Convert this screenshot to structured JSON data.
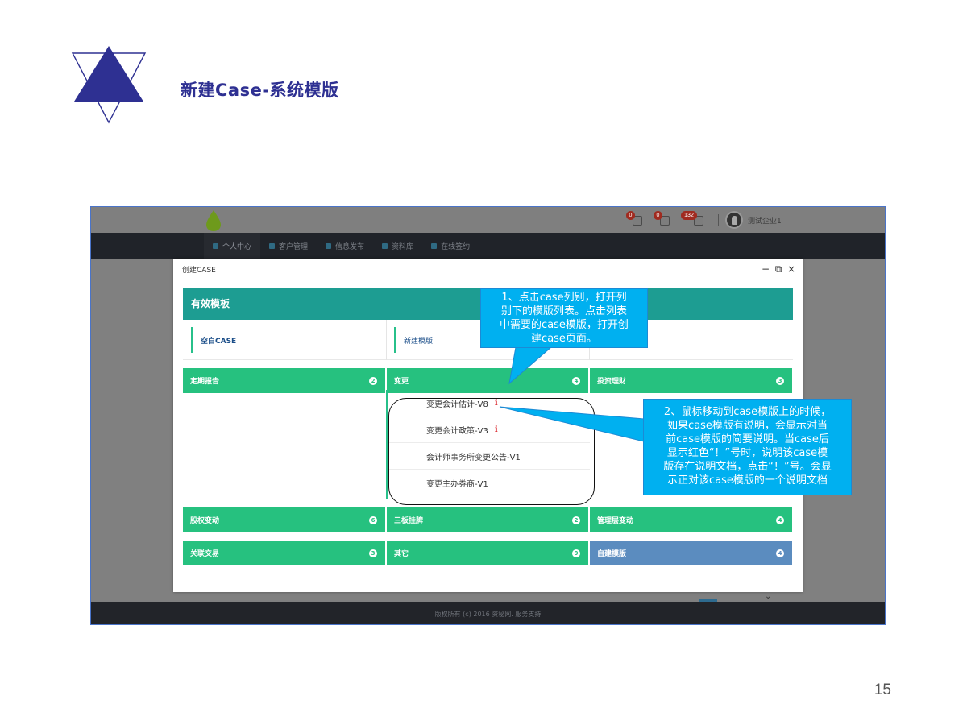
{
  "slide": {
    "title": "新建Case-系统模版",
    "page_number": "15"
  },
  "app": {
    "notifications": [
      {
        "icon": "bell-icon",
        "count": "0"
      },
      {
        "icon": "calendar-icon",
        "count": "0"
      },
      {
        "icon": "message-icon",
        "count": "132"
      }
    ],
    "company_name": "测试企业1",
    "nav": [
      {
        "label": "个人中心",
        "icon": "user-icon",
        "active": true
      },
      {
        "label": "客户管理",
        "icon": "chat-icon",
        "active": false
      },
      {
        "label": "信息发布",
        "icon": "document-icon",
        "active": false
      },
      {
        "label": "资料库",
        "icon": "database-icon",
        "active": false
      },
      {
        "label": "在线签约",
        "icon": "briefcase-icon",
        "active": false
      }
    ],
    "footer_text": "版权所有 (c) 2016 资秘网. 服务支持"
  },
  "modal": {
    "title": "创建CASE",
    "controls": {
      "minimize": "−",
      "maximize": "⧉",
      "close": "×"
    },
    "panel_title": "有效模板",
    "tiles": [
      "空白CASE",
      "新建模版"
    ],
    "categories": [
      {
        "label": "定期报告",
        "count": "2"
      },
      {
        "label": "变更",
        "count": "4"
      },
      {
        "label": "投资理财",
        "count": "3"
      },
      {
        "label": "股权变动",
        "count": "6"
      },
      {
        "label": "三板挂牌",
        "count": "2"
      },
      {
        "label": "管理层变动",
        "count": "4"
      },
      {
        "label": "关联交易",
        "count": "3"
      },
      {
        "label": "其它",
        "count": "9"
      },
      {
        "label": "自建模版",
        "count": "4"
      }
    ],
    "dropdown_items": [
      {
        "label": "变更会计估计-V8",
        "info": "i"
      },
      {
        "label": "变更会计政策-V3",
        "info": "i"
      },
      {
        "label": "会计师事务所变更公告-V1",
        "info": ""
      },
      {
        "label": "变更主办券商-V1",
        "info": ""
      }
    ]
  },
  "callouts": {
    "step1_lines": [
      "1、点击case列别，打开列",
      "别下的模版列表。点击列表",
      "中需要的case模版，打开创",
      "建case页面。"
    ],
    "step2_lines": [
      "2、鼠标移动到case模版上的时候，",
      "如果case模版有说明，会显示对当",
      "前case模版的简要说明。当case后",
      "显示红色“！”号时，说明该case模",
      "版存在说明文档，点击“！”号。会显",
      "示正对该case模版的一个说明文档"
    ]
  },
  "colors": {
    "title": "#2e3092",
    "teal_header": "#1d9d92",
    "category_green": "#26c17f",
    "category_blue": "#5b8cbf",
    "callout": "#00b0f0"
  }
}
